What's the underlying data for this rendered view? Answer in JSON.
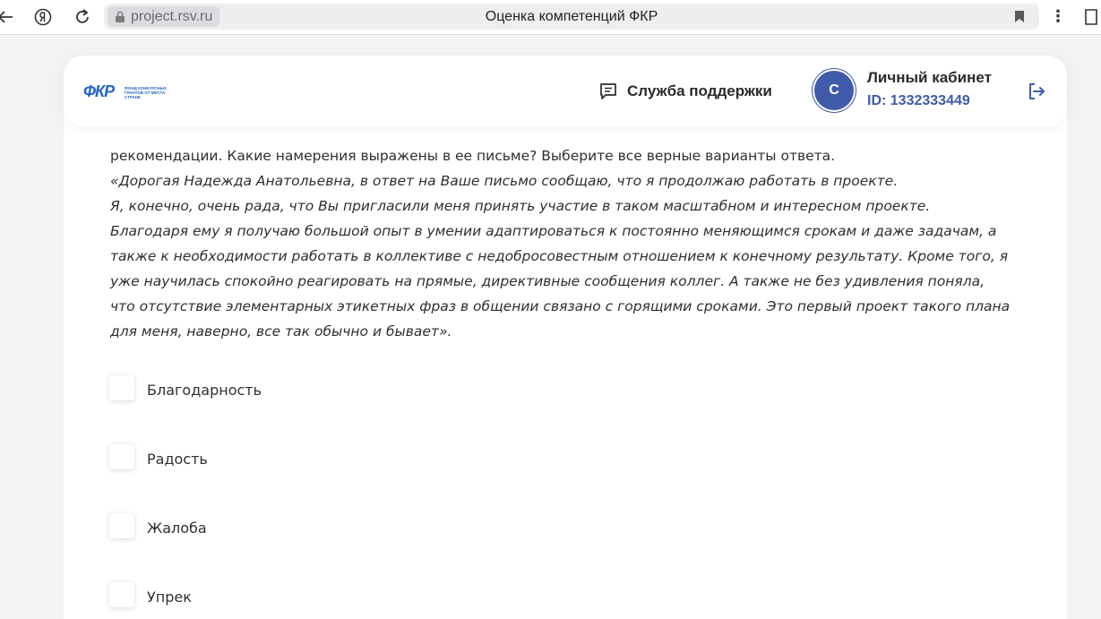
{
  "browser": {
    "url": "project.rsv.ru",
    "tab_title": "Оценка компетенций ФКР",
    "back_icon": "arrow-left-icon",
    "yandex_icon": "yandex-logo-icon",
    "reload_icon": "reload-icon",
    "lock_icon": "lock-icon",
    "bookmark_icon": "bookmark-icon",
    "menu_icon": "kebab-menu-icon",
    "extension_icon": "extension-icon"
  },
  "header": {
    "logo_mark": "ФКР",
    "logo_text": "ФОНД КОНКУРСНЫХ ГРАНТОВ ОТ МЕСТА СТРАНЕ",
    "support_label": "Служба поддержки",
    "avatar_letter": "С",
    "cabinet_title": "Личный кабинет",
    "cabinet_id": "ID: 1332333449",
    "colors": {
      "brand": "#2466c6",
      "avatar": "#3f5ba9"
    }
  },
  "question": {
    "lines": [
      "рекомендации. Какие намерения выражены в ее письме? Выберите все верные варианты ответа.",
      "«Дорогая Надежда Анатольевна, в ответ на Ваше письмо сообщаю, что я продолжаю работать в проекте.",
      "Я, конечно, очень рада, что Вы пригласили меня принять участие в таком масштабном и интересном проекте.",
      "Благодаря ему я получаю большой опыт в умении адаптироваться к постоянно меняющимся срокам и даже задачам, а",
      "также к необходимости работать в коллективе с недобросовестным отношением к конечному результату. Кроме того, я",
      "уже научилась спокойно реагировать на прямые, директивные сообщения коллег. А также не без удивления поняла,",
      "что отсутствие элементарных этикетных фраз в общении связано с горящими сроками. Это первый проект такого плана",
      "для меня, наверно, все так обычно и бывает»."
    ]
  },
  "options": [
    {
      "label": "Благодарность",
      "checked": false
    },
    {
      "label": "Радость",
      "checked": false
    },
    {
      "label": "Жалоба",
      "checked": false
    },
    {
      "label": "Упрек",
      "checked": false
    }
  ]
}
